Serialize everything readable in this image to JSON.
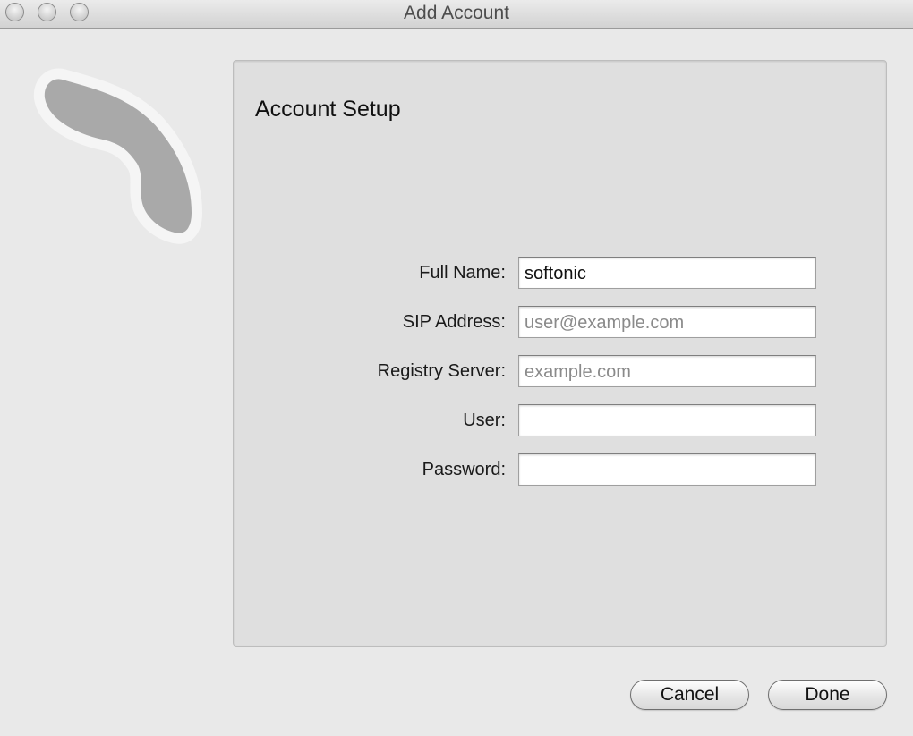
{
  "window": {
    "title": "Add Account"
  },
  "panel": {
    "title": "Account Setup"
  },
  "form": {
    "full_name": {
      "label": "Full Name:",
      "value": "softonic",
      "placeholder": ""
    },
    "sip_address": {
      "label": "SIP Address:",
      "value": "",
      "placeholder": "user@example.com"
    },
    "registry_server": {
      "label": "Registry Server:",
      "value": "",
      "placeholder": "example.com"
    },
    "user": {
      "label": "User:",
      "value": "",
      "placeholder": ""
    },
    "password": {
      "label": "Password:",
      "value": "",
      "placeholder": ""
    }
  },
  "buttons": {
    "cancel": "Cancel",
    "done": "Done"
  },
  "icons": {
    "window_controls": [
      "close-icon",
      "minimize-icon",
      "zoom-icon"
    ],
    "app_icon": "phone-handset-icon"
  }
}
